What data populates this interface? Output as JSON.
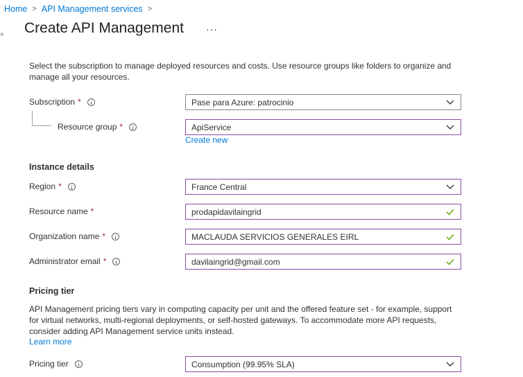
{
  "breadcrumb": {
    "home": "Home",
    "services": "API Management services"
  },
  "page": {
    "title": "Create API Management",
    "more": "···"
  },
  "intro_text": "Select the subscription to manage deployed resources and costs. Use resource groups like folders to organize and manage all your resources.",
  "subscription": {
    "label": "Subscription",
    "required": "*",
    "value": "Pase para Azure: patrocinio"
  },
  "resource_group": {
    "label": "Resource group",
    "required": "*",
    "value": "ApiService",
    "create_new": "Create new"
  },
  "instance": {
    "heading": "Instance details",
    "region": {
      "label": "Region",
      "required": "*",
      "value": "France Central"
    },
    "resource_name": {
      "label": "Resource name",
      "required": "*",
      "value": "prodapidavilaingrid"
    },
    "organization_name": {
      "label": "Organization name",
      "required": "*",
      "value": "MACLAUDA SERVICIOS GENERALES EIRL"
    },
    "admin_email": {
      "label": "Administrator email",
      "required": "*",
      "value": "davilaingrid@gmail.com"
    }
  },
  "pricing": {
    "heading": "Pricing tier",
    "description": "API Management pricing tiers vary in computing capacity per unit and the offered feature set - for example, support for virtual networks, multi-regional deployments, or self-hosted gateways. To accommodate more API requests, consider adding API Management service units instead.",
    "learn_more": "Learn more",
    "tier_label": "Pricing tier",
    "tier_value": "Consumption (99.95% SLA)"
  },
  "colors": {
    "link": "#0078d4",
    "required": "#a4262c",
    "focus_border": "#8a4ba3",
    "valid_check": "#57a300"
  }
}
